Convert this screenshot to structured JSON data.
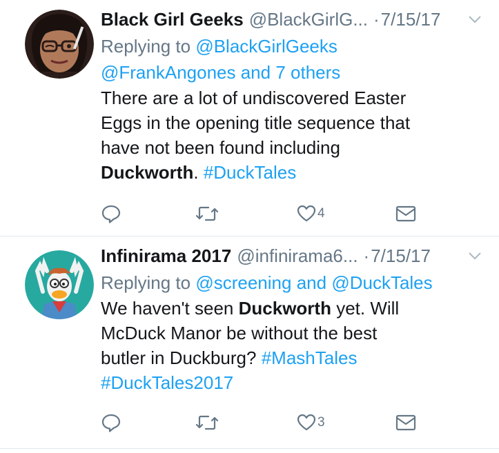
{
  "tweets": [
    {
      "author": {
        "name": "Black Girl Geeks",
        "handle": "@BlackGirlG...",
        "avatar": "woman-winking-avatar"
      },
      "date": "7/15/17",
      "replying_prefix": "Replying to",
      "replying_to_1": "@BlackGirlGeeks",
      "replying_to_2": "@FrankAngones and 7 others",
      "text": {
        "line1": "There are a lot of undiscovered Easter",
        "line2": "Eggs in the opening title sequence that",
        "line3": "have not been found including",
        "bold": "Duckworth",
        "after_bold": ".",
        "hashtag": "#DuckTales"
      },
      "actions": {
        "reply": "reply-icon",
        "retweet": "retweet-icon",
        "like": "heart-icon",
        "like_count": "4",
        "dm": "envelope-icon"
      }
    },
    {
      "author": {
        "name": "Infinirama 2017",
        "handle": "@infinirama6...",
        "avatar": "duck-character-avatar"
      },
      "date": "7/15/17",
      "replying_prefix": "Replying to",
      "replying_to_1": "@screening",
      "and": "and",
      "replying_to_2": "@DuckTales",
      "text": {
        "before_bold": "We haven't seen",
        "bold": "Duckworth",
        "after_bold": "yet. Will",
        "line2": "McDuck Manor be without the best",
        "line3": "butler in Duckburg?",
        "hashtag1": "#MashTales",
        "hashtag2": "#DuckTales2017"
      },
      "actions": {
        "reply": "reply-icon",
        "retweet": "retweet-icon",
        "like": "heart-icon",
        "like_count": "3",
        "dm": "envelope-icon"
      }
    }
  ],
  "colors": {
    "link": "#1da1f2",
    "muted": "#657786",
    "text": "#14171a",
    "divider": "#e1e8ed"
  }
}
